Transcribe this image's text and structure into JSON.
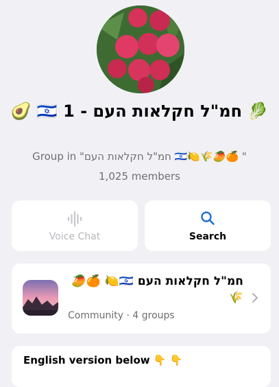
{
  "group": {
    "title": "🥑 🇮🇱 1 - חמ\"ל חקלאות העם 🥬",
    "subtitle": "Group in \"חמ\"ל חקלאות העם 🇮🇱🍋🌾🥭🍊 \"",
    "members": "1,025 members",
    "avatar_icon": "lychee-photo"
  },
  "actions": {
    "voice_chat": "Voice Chat",
    "search": "Search"
  },
  "community": {
    "name": "חמ\"ל חקלאות העם 🇮🇱🍋 🍊🥭🌾",
    "meta": "Community · 4 groups"
  },
  "description": {
    "text": "English version below 👇 👇"
  },
  "colors": {
    "background": "#f0f0f5",
    "accent": "#1f6fd1",
    "secondary_text": "#6e6e73",
    "disabled": "#b8b8bd"
  }
}
